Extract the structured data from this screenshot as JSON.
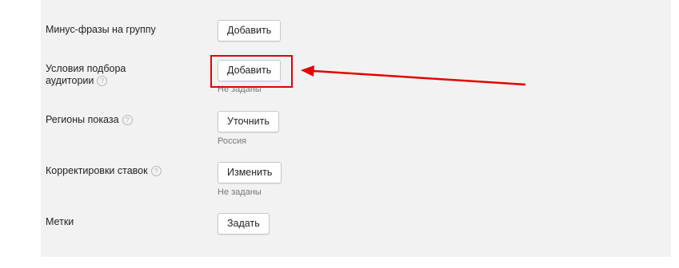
{
  "rows": [
    {
      "label": "Минус-фразы на группу",
      "button": "Добавить",
      "note": ""
    },
    {
      "label_line1": "Условия подбора",
      "label_line2": "аудитории",
      "button": "Добавить",
      "note": "Не заданы"
    },
    {
      "label": "Регионы показа",
      "button": "Уточнить",
      "note": "Россия"
    },
    {
      "label": "Корректировки ставок",
      "button": "Изменить",
      "note": "Не заданы"
    },
    {
      "label": "Метки",
      "button": "Задать",
      "note": ""
    }
  ],
  "help_glyph": "?",
  "annotation": {
    "color": "#e60000"
  }
}
